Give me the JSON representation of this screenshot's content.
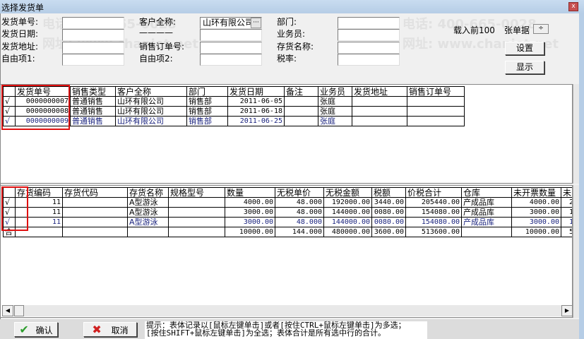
{
  "window": {
    "title": "选择发货单",
    "close": "x"
  },
  "filter": {
    "labels": [
      "发货单号:",
      "发货日期:",
      "发货地址:",
      "自由项1:",
      "客户全称:",
      "————",
      "销售订单号:",
      "自由项2:",
      "部门:",
      "业务员:",
      "存货名称:",
      "税率:"
    ],
    "customer_value": "山环有限公司",
    "load_prefix": "载入前100",
    "load_suffix": "张单据",
    "settings_button": "设置",
    "show_button": "显示"
  },
  "upper_table": {
    "headers": [
      "",
      "发货单号",
      "销售类型",
      "客户全称",
      "部门",
      "发货日期",
      "备注",
      "业务员",
      "发货地址",
      "销售订单号"
    ],
    "rows": [
      [
        "√",
        "0000000007",
        "普通销售",
        "山环有限公司",
        "销售部",
        "2011-06-05",
        "",
        "张庭",
        "",
        ""
      ],
      [
        "√",
        "0000000008",
        "普通销售",
        "山环有限公司",
        "销售部",
        "2011-06-18",
        "",
        "张庭",
        "",
        ""
      ],
      [
        "√",
        "0000000009",
        "普通销售",
        "山环有限公司",
        "销售部",
        "2011-06-25",
        "",
        "张庭",
        "",
        ""
      ]
    ]
  },
  "lower_table": {
    "headers": [
      "",
      "存货编码",
      "存货代码",
      "存货名称",
      "规格型号",
      "数量",
      "无税单价",
      "无税金额",
      "税额",
      "价税合计",
      "仓库",
      "未开票数量",
      "未"
    ],
    "rows": [
      [
        "√",
        "11",
        "",
        "A型游泳",
        "",
        "4000.00",
        "48.000",
        "192000.00",
        "3440.00",
        "205440.00",
        "产成品库",
        "4000.00",
        "2"
      ],
      [
        "√",
        "11",
        "",
        "A型游泳",
        "",
        "3000.00",
        "48.000",
        "144000.00",
        "0080.00",
        "154080.00",
        "产成品库",
        "3000.00",
        "1"
      ],
      [
        "√",
        "11",
        "",
        "A型游泳",
        "",
        "3000.00",
        "48.000",
        "144000.00",
        "0080.00",
        "154080.00",
        "产成品库",
        "3000.00",
        "1"
      ]
    ],
    "total": [
      "合",
      "",
      "",
      "",
      "",
      "10000.00",
      "144.000",
      "480000.00",
      "3600.00",
      "513600.00",
      "",
      "10000.00",
      "5"
    ]
  },
  "footer": {
    "confirm": "确认",
    "cancel": "取消",
    "hint_line1": "提示：表体记录以[鼠标左键单击]或者[按住CTRL+鼠标左键单击]为多选；",
    "hint_line2": "[按住SHIFT+鼠标左键单击]为全选；表体合计是所有选中行的合计。"
  },
  "watermark": [
    "电话: 400-665-0028",
    "网址: www.chanjet.net"
  ],
  "colors": {
    "highlight_box": "#e01010",
    "selected_row_text": "#1a237e",
    "confirm_icon": "#2e9e2e",
    "cancel_icon": "#d02020"
  }
}
